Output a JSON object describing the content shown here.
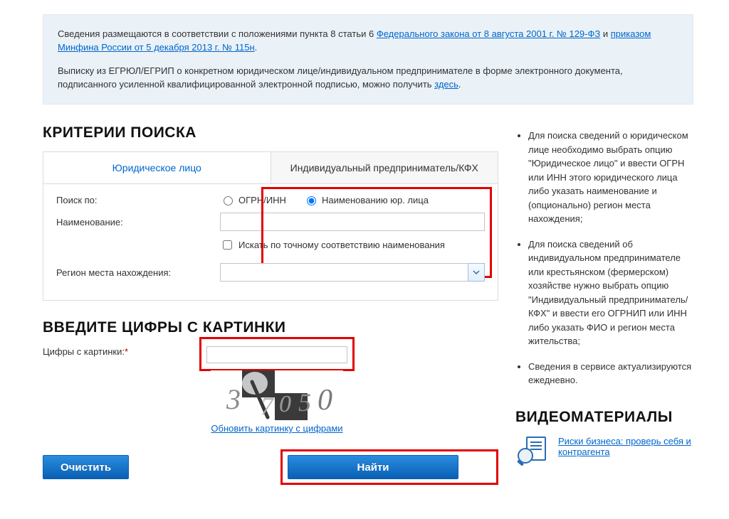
{
  "notice": {
    "p1_prefix": "Сведения размещаются в соответствии с положениями пункта 8 статьи 6 ",
    "p1_link1": "Федерального закона от 8 августа 2001 г. № 129-ФЗ",
    "p1_mid": " и ",
    "p1_link2": "приказом Минфина России от 5 декабря 2013 г. № 115н",
    "p1_suffix": ".",
    "p2_prefix": "Выписку из ЕГРЮЛ/ЕГРИП о конкретном юридическом лице/индивидуальном предпринимателе в форме электронного документа, подписанного усиленной квалифицированной электронной подписью, можно получить ",
    "p2_link": "здесь",
    "p2_suffix": "."
  },
  "criteria": {
    "heading": "КРИТЕРИИ ПОИСКА",
    "tabs": {
      "legal": "Юридическое лицо",
      "indiv": "Индивидуальный предприниматель/КФХ"
    },
    "labels": {
      "search_by": "Поиск по:",
      "name": "Наименование:",
      "region": "Регион места нахождения:"
    },
    "radios": {
      "ogrn": "ОГРН/ИНН",
      "by_name": "Наименованию юр. лица"
    },
    "exact_label": "Искать по точному соответствию наименования"
  },
  "captcha": {
    "heading": "ВВЕДИТЕ ЦИФРЫ С КАРТИНКИ",
    "label": "Цифры с картинки:",
    "required": "*",
    "digits": [
      "3",
      "7",
      "0",
      "5",
      "0"
    ],
    "refresh": "Обновить картинку с цифрами"
  },
  "buttons": {
    "clear": "Очистить",
    "find": "Найти"
  },
  "help": {
    "items": [
      "Для поиска сведений о юридическом лице необходимо выбрать опцию \"Юридическое лицо\" и ввести ОГРН или ИНН этого юридического лица либо указать наименование и (опционально) регион места нахождения;",
      "Для поиска сведений об индивидуальном предпринимателе или крестьянском (фермерском) хозяйстве нужно выбрать опцию \"Индивидуальный предприниматель/КФХ\" и ввести его ОГРНИП или ИНН либо указать ФИО и регион места жительства;",
      "Сведения в сервисе актуализируются ежедневно."
    ]
  },
  "video": {
    "heading": "ВИДЕОМАТЕРИАЛЫ",
    "link": "Риски бизнеса: проверь себя и контрагента"
  }
}
